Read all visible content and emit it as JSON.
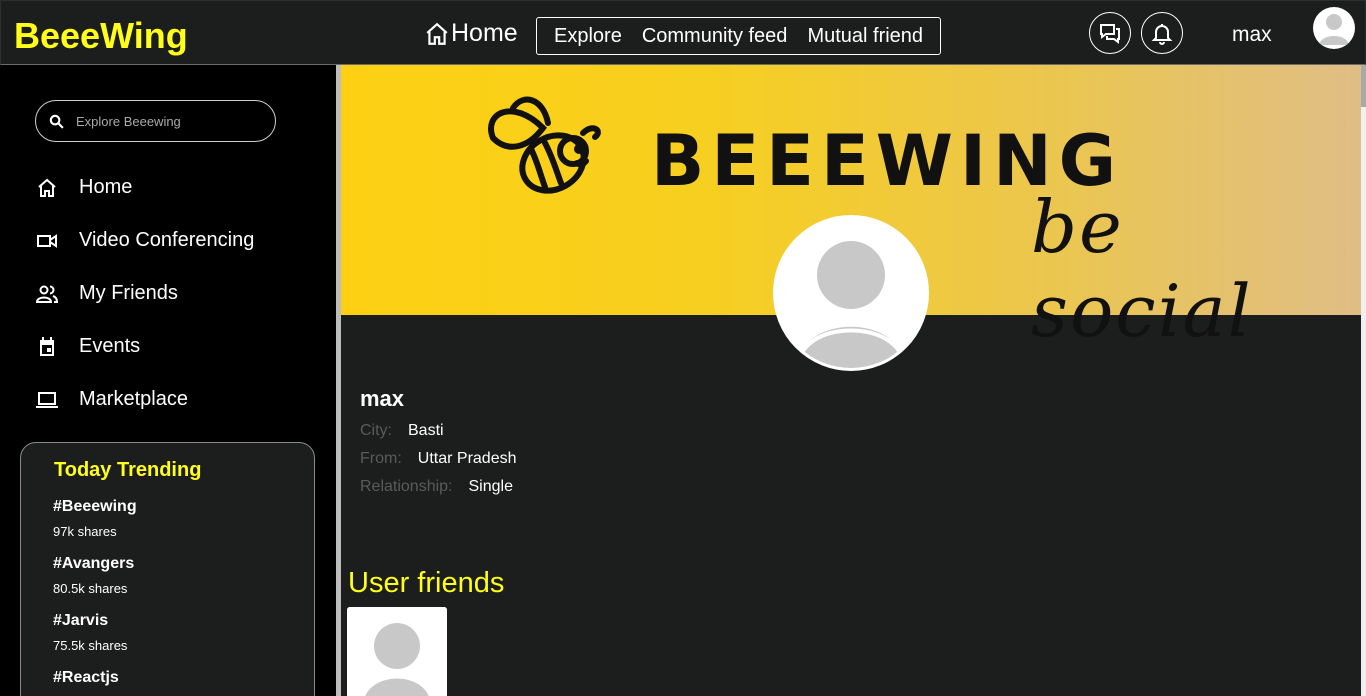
{
  "header": {
    "logo": "BeeeWing",
    "home_label": "Home",
    "nav": [
      "Explore",
      "Community feed",
      "Mutual friend"
    ],
    "username": "max"
  },
  "sidebar": {
    "search_placeholder": "Explore Beeewing",
    "items": [
      {
        "label": "Home",
        "icon": "home-icon"
      },
      {
        "label": "Video Conferencing",
        "icon": "video-icon"
      },
      {
        "label": "My Friends",
        "icon": "friends-icon"
      },
      {
        "label": "Events",
        "icon": "calendar-icon"
      },
      {
        "label": "Marketplace",
        "icon": "laptop-icon"
      }
    ],
    "trending": {
      "title": "Today Trending",
      "items": [
        {
          "tag": "#Beeewing",
          "count": "97k shares"
        },
        {
          "tag": "#Avangers",
          "count": "80.5k shares"
        },
        {
          "tag": "#Jarvis",
          "count": "75.5k shares"
        },
        {
          "tag": "#Reactjs",
          "count": ""
        }
      ]
    }
  },
  "cover": {
    "brand": "BEEEWING",
    "tagline": "be social"
  },
  "profile": {
    "name": "max",
    "city_label": "City:",
    "city": "Basti",
    "from_label": "From:",
    "from": "Uttar Pradesh",
    "relationship_label": "Relationship:",
    "relationship": "Single"
  },
  "friends": {
    "title": "User friends"
  },
  "colors": {
    "accent": "#ffff1a",
    "background": "#1c1d1d",
    "sidebar": "#000000"
  }
}
